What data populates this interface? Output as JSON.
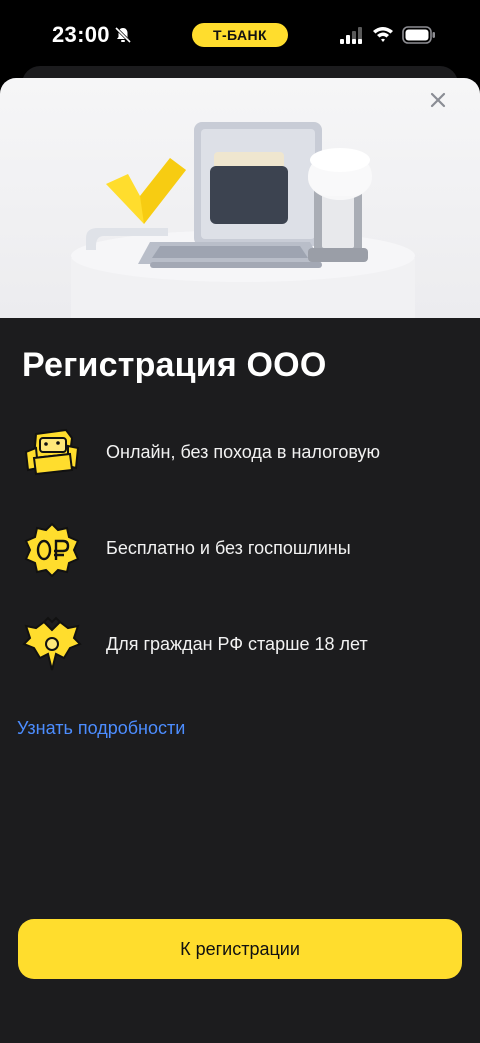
{
  "status_bar": {
    "time": "23:00",
    "carrier_badge": "Т-БАНК",
    "icons": [
      "bell-off-icon",
      "cellular-signal-icon",
      "wifi-icon",
      "battery-icon"
    ]
  },
  "sheet": {
    "close_icon": "close-icon",
    "title": "Регистрация ООО",
    "features": [
      {
        "icon": "armchair-icon",
        "text": "Онлайн, без похода в налоговую"
      },
      {
        "icon": "zero-ruble-badge-icon",
        "text": "Бесплатно и без госпошлины"
      },
      {
        "icon": "eagle-emblem-icon",
        "text": "Для граждан РФ старше 18 лет"
      }
    ],
    "details_link": "Узнать подробности",
    "cta_label": "К регистрации"
  },
  "colors": {
    "accent": "#ffdd2d",
    "link": "#4c8dff",
    "sheet_background": "#1c1c1e",
    "screen_background": "#000000"
  }
}
